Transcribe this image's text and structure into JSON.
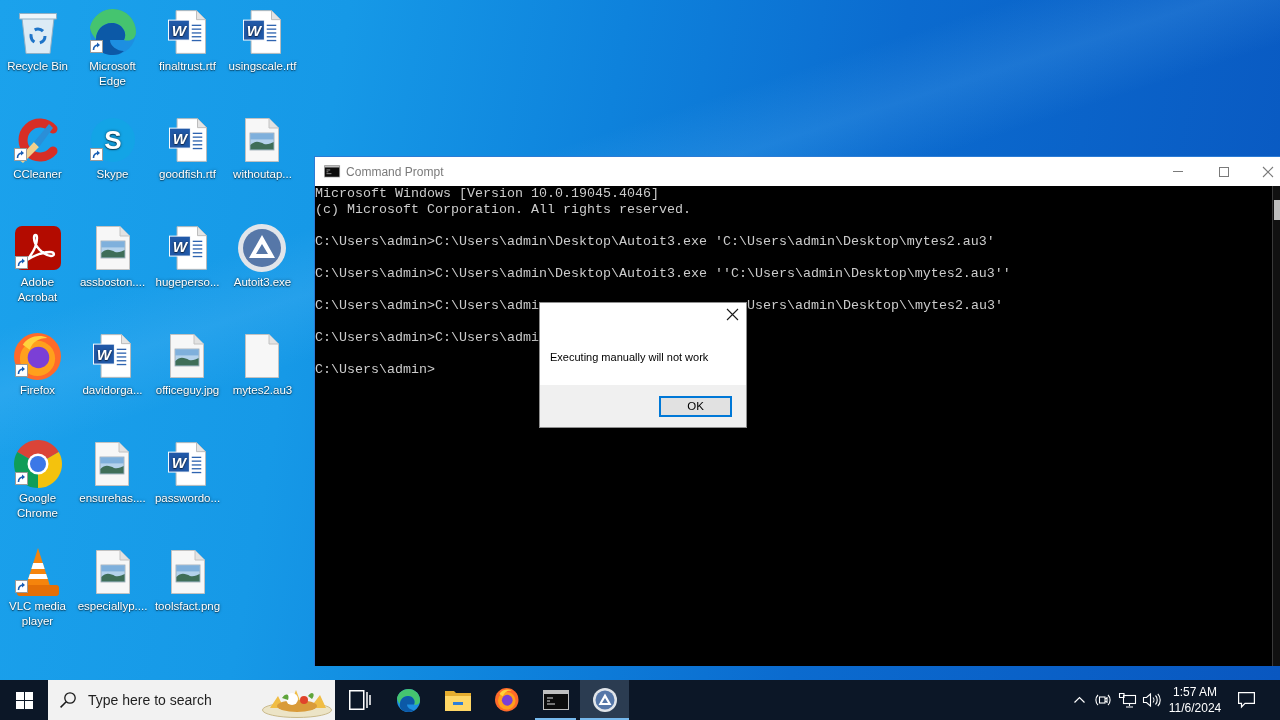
{
  "desktop": {
    "icons": [
      {
        "label": "Recycle Bin",
        "kind": "recycle_bin",
        "shortcut": false
      },
      {
        "label": "CCleaner",
        "kind": "ccleaner",
        "shortcut": true
      },
      {
        "label": "Adobe Acrobat",
        "kind": "acrobat",
        "shortcut": true
      },
      {
        "label": "Firefox",
        "kind": "firefox",
        "shortcut": true
      },
      {
        "label": "Google Chrome",
        "kind": "chrome",
        "shortcut": true
      },
      {
        "label": "VLC media player",
        "kind": "vlc",
        "shortcut": true
      },
      {
        "label": "Microsoft Edge",
        "kind": "edge",
        "shortcut": true
      },
      {
        "label": "Skype",
        "kind": "skype",
        "glyph": "S",
        "shortcut": true
      },
      {
        "label": "assboston....",
        "kind": "image_file",
        "shortcut": false
      },
      {
        "label": "davidorga...",
        "kind": "word_doc",
        "glyph": "W",
        "shortcut": false
      },
      {
        "label": "ensurehas....",
        "kind": "image_file",
        "shortcut": false
      },
      {
        "label": "especiallyp....",
        "kind": "image_file",
        "shortcut": false
      },
      {
        "label": "finaltrust.rtf",
        "kind": "word_doc",
        "glyph": "W",
        "shortcut": false
      },
      {
        "label": "goodfish.rtf",
        "kind": "word_doc",
        "glyph": "W",
        "shortcut": false
      },
      {
        "label": "hugeperso...",
        "kind": "word_doc",
        "glyph": "W",
        "shortcut": false
      },
      {
        "label": "officeguy.jpg",
        "kind": "image_file",
        "shortcut": false
      },
      {
        "label": "passwordo...",
        "kind": "word_doc",
        "glyph": "W",
        "shortcut": false
      },
      {
        "label": "toolsfact.png",
        "kind": "image_file",
        "shortcut": false
      },
      {
        "label": "usingscale.rtf",
        "kind": "word_doc",
        "glyph": "W",
        "shortcut": false
      },
      {
        "label": "withoutap...",
        "kind": "image_file",
        "shortcut": false
      },
      {
        "label": "Autoit3.exe",
        "kind": "autoit",
        "shortcut": false
      },
      {
        "label": "mytes2.au3",
        "kind": "blank_file",
        "shortcut": false
      }
    ]
  },
  "command_window": {
    "title": "Command Prompt",
    "active": false,
    "console": {
      "blocks": [
        {
          "lines": [
            [
              "Microsoft Windows [Version 10.0.19045.4046]"
            ],
            [
              "(c) Microsoft Corporation. All rights reserved."
            ]
          ]
        },
        {
          "lines": [
            [
              "C:\\Users\\admin>C:\\Users\\admin\\Desktop\\Autoit3.exe 'C:\\Users\\admin\\Desktop\\mytes2.au3'"
            ]
          ]
        },
        {
          "lines": [
            [
              "C:\\Users\\admin>C:\\Users\\admin\\Desktop\\Autoit3.exe ''C:\\Users\\admin\\Desktop\\mytes2.au3''"
            ]
          ]
        },
        {
          "lines": [
            [
              "C:\\Users\\admin>C:\\Users\\admi",
              "Users\\admin\\Desktop\\\\mytes2.au3'"
            ]
          ]
        },
        {
          "lines": [
            [
              "C:\\Users\\admin>C:\\Users\\admi"
            ]
          ]
        },
        {
          "lines": [
            [
              "C:\\Users\\admin>"
            ]
          ]
        }
      ]
    }
  },
  "message_box": {
    "message": "Executing manually will not work",
    "button": "OK"
  },
  "taskbar": {
    "search": {
      "placeholder": "Type here to search"
    },
    "buttons": [
      {
        "kind": "task_view",
        "running": false,
        "active": false
      },
      {
        "kind": "edge",
        "running": false,
        "active": false
      },
      {
        "kind": "folder",
        "running": false,
        "active": false
      },
      {
        "kind": "firefox",
        "running": false,
        "active": false
      },
      {
        "kind": "terminal",
        "running": true,
        "active": false
      },
      {
        "kind": "autoit",
        "running": true,
        "active": true
      }
    ],
    "clock": {
      "time": "1:57 AM",
      "date": "11/6/2024"
    }
  }
}
